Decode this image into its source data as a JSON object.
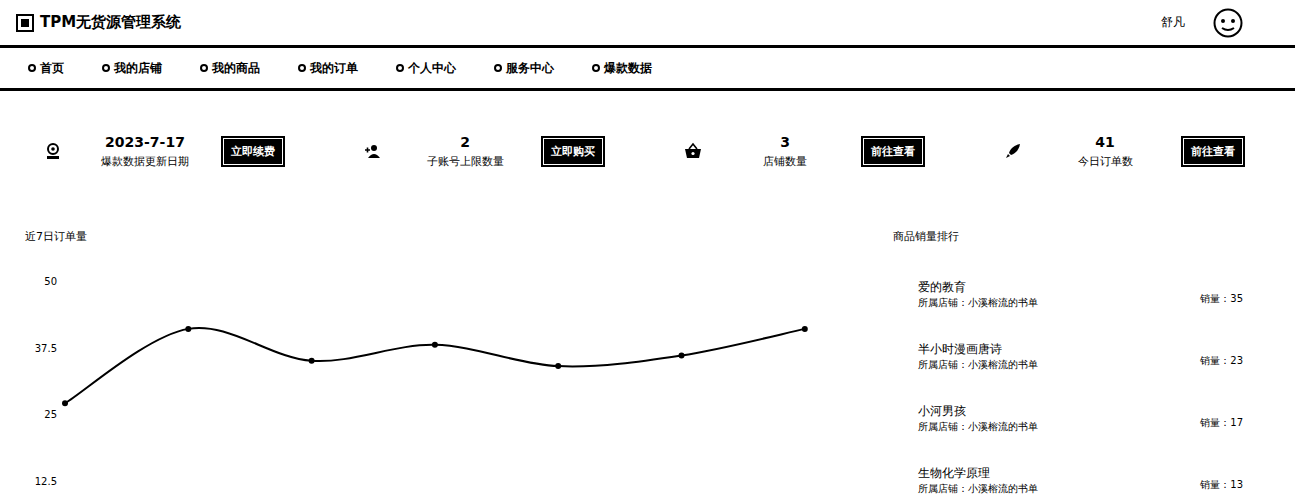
{
  "window": {
    "title": "TPM无货源管理系统"
  },
  "user": {
    "name": "舒凡"
  },
  "nav": [
    {
      "label": "首页",
      "selected": false
    },
    {
      "label": "我的店铺",
      "selected": false
    },
    {
      "label": "我的商品",
      "selected": false
    },
    {
      "label": "我的订单",
      "selected": false
    },
    {
      "label": "个人中心",
      "selected": false
    },
    {
      "label": "服务中心",
      "selected": false
    },
    {
      "label": "爆款数据",
      "selected": false
    }
  ],
  "stats": [
    {
      "kind": "camera",
      "value": "2023-7-17",
      "label": "爆款数据更新日期",
      "button": "立即续费"
    },
    {
      "kind": "users",
      "value": "2",
      "label": "子账号上限数量",
      "button": "立即购买"
    },
    {
      "kind": "basket",
      "value": "3",
      "label": "店铺数量",
      "button": "前往查看"
    },
    {
      "kind": "rocket",
      "value": "41",
      "label": "今日订单数",
      "button": "前往查看"
    }
  ],
  "chart": {
    "title": "近7日订单量",
    "ticks": [
      "50",
      "37.5",
      "25",
      "12.5"
    ],
    "series": [
      {
        "name": "订单量",
        "values": [
          27,
          41,
          35,
          38,
          34,
          36,
          41
        ]
      }
    ]
  },
  "ranking": {
    "title": "商品销量排行",
    "items": [
      {
        "name": "爱的教育",
        "shop": "所属店铺：小溪榕流的书单",
        "sales": "销量：35"
      },
      {
        "name": "半小时漫画唐诗",
        "shop": "所属店铺：小溪榕流的书单",
        "sales": "销量：23"
      },
      {
        "name": "小河男孩",
        "shop": "所属店铺：小溪榕流的书单",
        "sales": "销量：17"
      },
      {
        "name": "生物化学原理",
        "shop": "所属店铺：小溪榕流的书单",
        "sales": "销量：13"
      }
    ]
  }
}
